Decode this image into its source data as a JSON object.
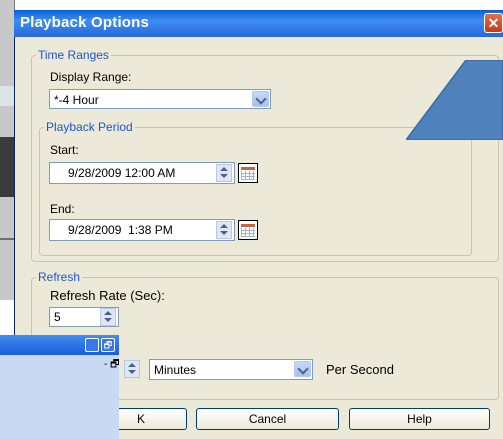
{
  "dialog": {
    "title": "Playback Options",
    "close_glyph": "✕"
  },
  "time_ranges": {
    "legend": "Time Ranges",
    "display_range_label": "Display Range:",
    "display_range_value": "*-4 Hour",
    "playback_period": {
      "legend": "Playback Period",
      "start_label": "Start:",
      "start_value": "9/28/2009 12:00 AM",
      "end_label": "End:",
      "end_value": "9/28/2009  1:38 PM"
    }
  },
  "refresh": {
    "legend": "Refresh",
    "rate_label": "Refresh Rate (Sec):",
    "rate_value": "5",
    "unit_value": "Minutes",
    "per_second_label": "Per Second"
  },
  "buttons": {
    "ok_partial": "K",
    "cancel": "Cancel",
    "help": "Help"
  },
  "mini_window": {
    "restore_glyph": "🗗",
    "minus_text": "- 🗗"
  },
  "colors": {
    "title_bar": "#2767d6",
    "legend_text": "#1c56d6",
    "callout_fill": "#4f81bd",
    "dialog_bg": "#ece9d8"
  },
  "icons": [
    "close-icon",
    "chevron-down-icon",
    "spin-up-icon",
    "spin-down-icon",
    "calendar-icon",
    "callout-arrow"
  ]
}
